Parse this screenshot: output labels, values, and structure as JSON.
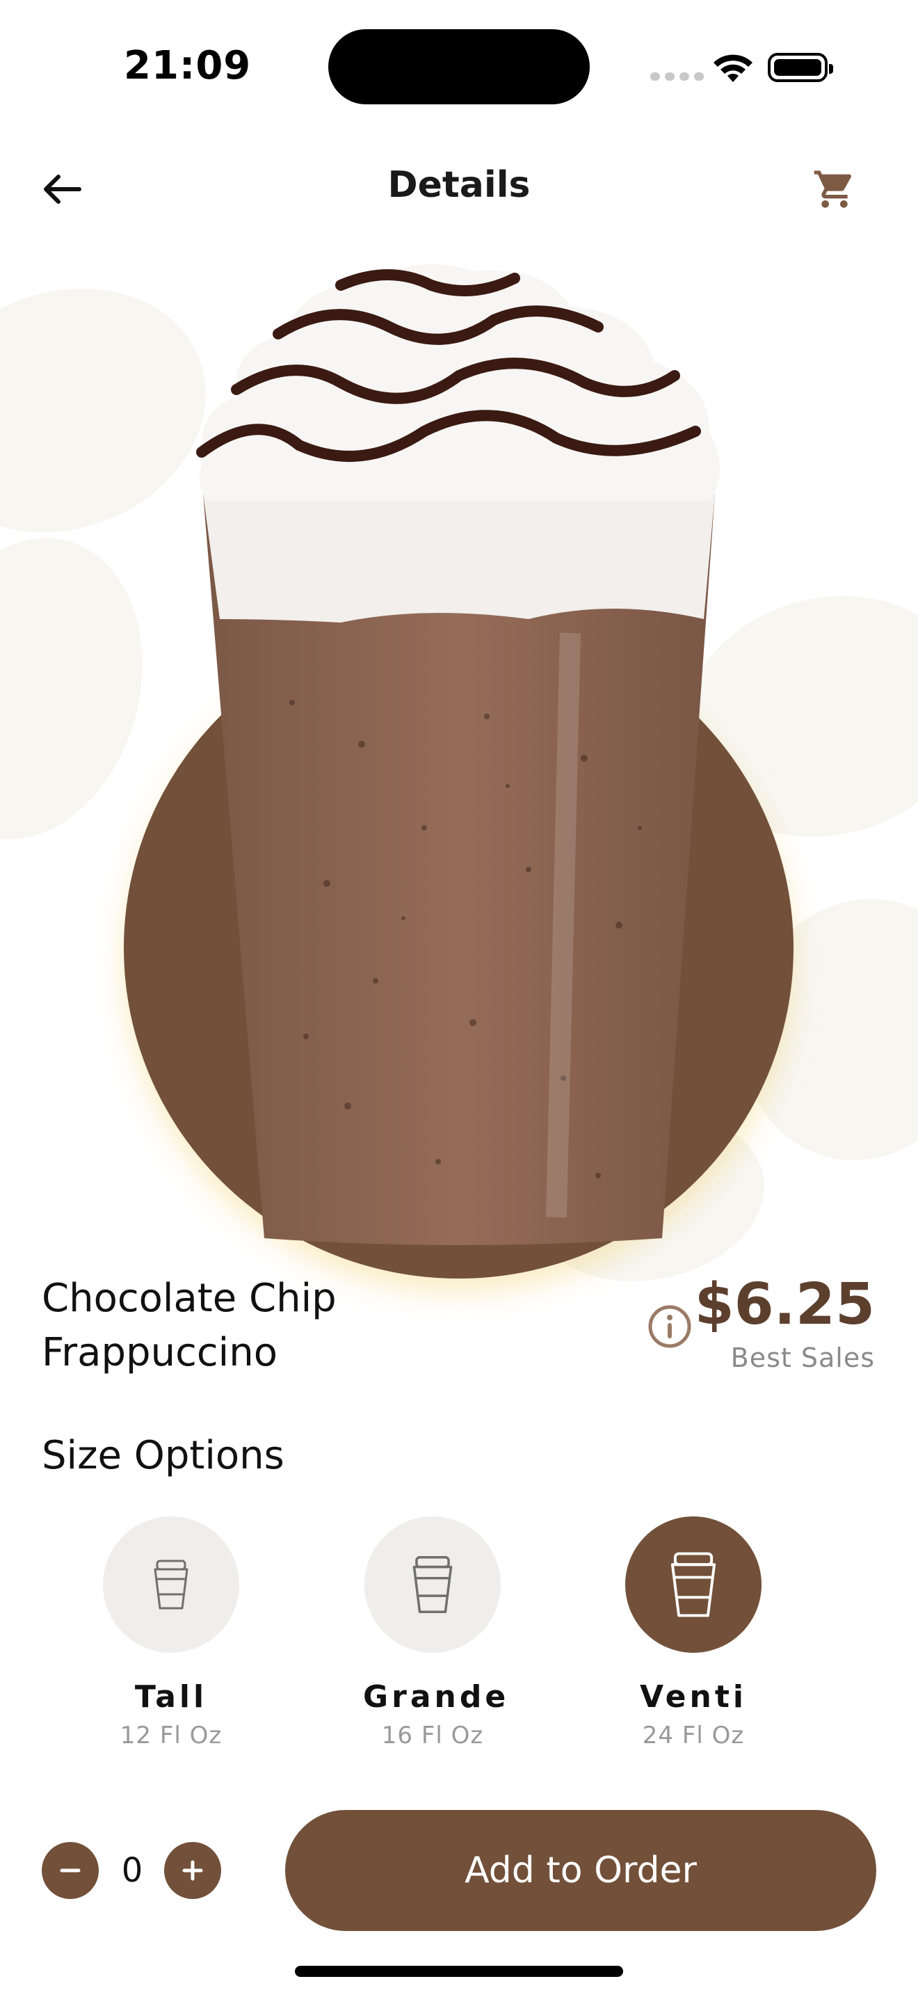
{
  "status_bar": {
    "time": "21:09"
  },
  "header": {
    "title": "Details",
    "back_icon": "arrow-left-icon",
    "cart_icon": "cart-icon"
  },
  "product": {
    "name_line1": "Chocolate Chip",
    "name_line2": "Frappuccino",
    "price": "$6.25",
    "tag": "Best Sales"
  },
  "sizes": {
    "title": "Size Options",
    "options": [
      {
        "label": "Tall",
        "volume": "12 Fl Oz",
        "selected": false
      },
      {
        "label": "Grande",
        "volume": "16 Fl Oz",
        "selected": false
      },
      {
        "label": "Venti",
        "volume": "24 Fl Oz",
        "selected": true
      }
    ]
  },
  "order": {
    "quantity": "0",
    "button_label": "Add to Order"
  },
  "colors": {
    "accent": "#725039",
    "price": "#5d3f2e",
    "bean": "#f7f6f1",
    "size_disc": "#efeeec"
  }
}
